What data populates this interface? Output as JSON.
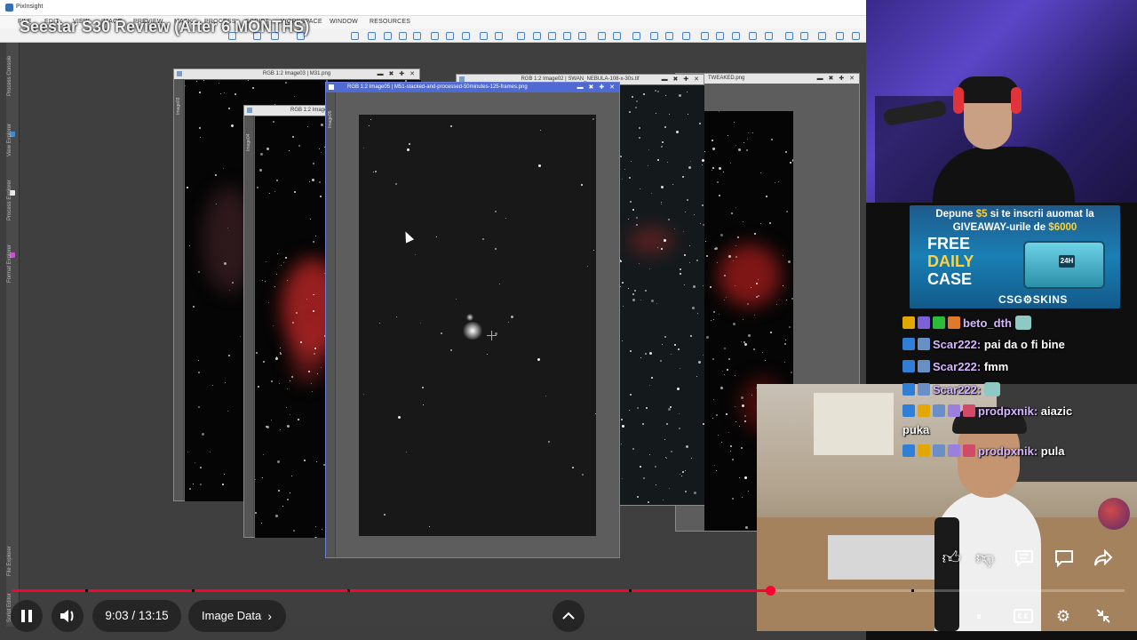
{
  "video": {
    "title": "Seestar S30 Review (After 6 MONTHS)",
    "time_display": "9:03 / 13:15",
    "chapter": "Image Data",
    "progress": 0.6813
  },
  "pixinsight": {
    "app_name": "PixInsight",
    "menu": [
      "FILE",
      "EDIT",
      "VIEW",
      "IMAGE",
      "PREVIEW",
      "MASK",
      "PROCESS",
      "SCRIPT",
      "WORKSPACE",
      "WINDOW",
      "RESOURCES"
    ],
    "dock_labels": [
      "Process Console",
      "View Explorer",
      "Process Explorer",
      "Format Explorer",
      "File Explorer",
      "Script Editor"
    ],
    "windows": [
      {
        "title": "RGB 1:2 Image03 | M31.png",
        "side": "Image03"
      },
      {
        "title": "RGB 1:2 Image04",
        "side": "Image04"
      },
      {
        "title": "RGB 1:2 Image02 | SWAN_NEBULA-108-x-30s.tif",
        "side": "Image02"
      },
      {
        "title": "TWEAKED.png",
        "side": ""
      },
      {
        "title": "RGB 1:2 Image05 | M51-stacked-and-processed-50minutes-125-frames.png",
        "side": "Image05"
      }
    ]
  },
  "ad": {
    "headline_pre": "Depune ",
    "headline_amount": "$5",
    "headline_mid": " si te inscrii auomat la ",
    "headline_giveaway": "GIVEAWAY",
    "headline_post": "-urile de ",
    "headline_prize": "$6000",
    "free": "FREE",
    "daily": "DAILY",
    "case": "CASE",
    "brand": "CSG⚙SKINS",
    "case_tag": "24H"
  },
  "chat": [
    {
      "user": "beto_dth",
      "msg": "",
      "user_color": "#d7b6ff"
    },
    {
      "user": "Scar222:",
      "msg": "pai da o fi bine",
      "user_color": "#d7b6ff"
    },
    {
      "user": "Scar222:",
      "msg": "fmm",
      "user_color": "#d7b6ff"
    },
    {
      "user": "Scar222:",
      "msg": "",
      "user_color": "#d7b6ff"
    },
    {
      "user": "prodpxnik:",
      "msg": "aiazic",
      "msg2": "puka",
      "user_color": "#d7b6ff"
    },
    {
      "user": "prodpxnik:",
      "msg": "pula",
      "user_color": "#d7b6ff"
    }
  ],
  "colors": {
    "accent": "#ff0033",
    "active_window": "#4f6bd3"
  },
  "icons": [
    "pause-icon",
    "volume-icon",
    "chevron-right-icon",
    "chevron-up-icon",
    "like-icon",
    "dislike-icon",
    "comment-icon",
    "chat-icon",
    "share-icon",
    "captions-icon",
    "settings-icon",
    "fullscreen-exit-icon"
  ]
}
